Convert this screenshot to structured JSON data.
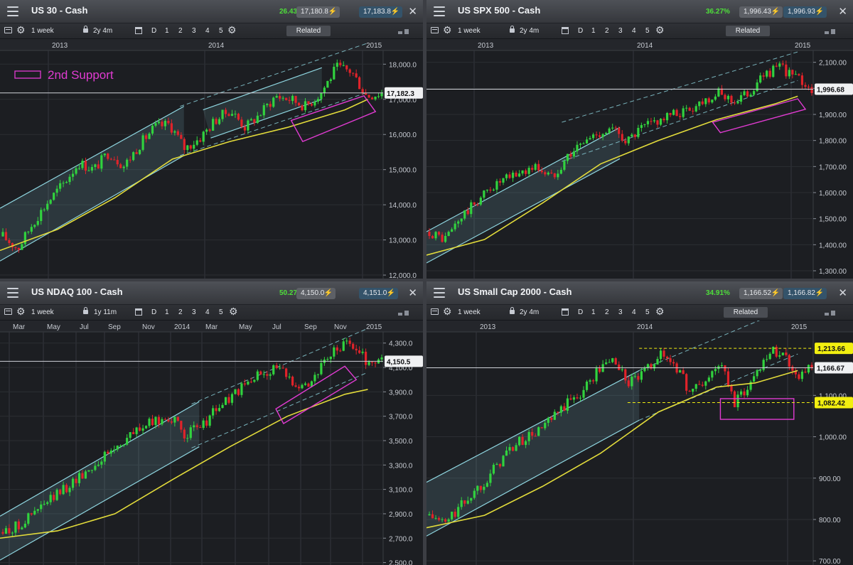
{
  "colors": {
    "up": "#31d23e",
    "down": "#e0232a",
    "channel": "#8fd6e0",
    "ma": "#e3dc3b",
    "annot": "#e13bd2",
    "level": "#f2ef10",
    "pct": "#4ede3a"
  },
  "toolbar_common": {
    "digits": [
      "D",
      "1",
      "2",
      "3",
      "4",
      "5"
    ],
    "related_label": "Related"
  },
  "panels": [
    {
      "title": "US 30 - Cash",
      "pct": "26.43%",
      "sell": "17,180.8",
      "buy": "17,183.8",
      "interval": "1 week",
      "range": "2y 4m",
      "show_related": true,
      "current_price": "17,182.3",
      "annotation_label": "2nd Support",
      "chart_data": {
        "type": "candlestick",
        "x_ticks": [
          "2013",
          "2014",
          "2015"
        ],
        "y_ticks": [
          "18,000.0",
          "17,000.0",
          "16,000.0",
          "15,000.0",
          "14,000.0",
          "13,000.0",
          "12,000.0"
        ],
        "y_range": [
          11900,
          18350
        ],
        "close_path": [
          13100,
          12750,
          13500,
          14100,
          14600,
          15200,
          15000,
          15500,
          15100,
          15700,
          16200,
          16300,
          15600,
          15900,
          16400,
          16700,
          16200,
          16600,
          17100,
          17000,
          16800,
          17200,
          17900,
          17800,
          17100,
          17182
        ],
        "channels": [
          {
            "from": [
              0,
              13900
            ],
            "to": [
              0.48,
              16800
            ]
          },
          {
            "from": [
              0,
              12400
            ],
            "to": [
              0.48,
              15400
            ]
          },
          {
            "from": [
              0.53,
              16700
            ],
            "to": [
              0.84,
              17900
            ]
          },
          {
            "from": [
              0.55,
              15900
            ],
            "to": [
              0.84,
              17000
            ]
          }
        ],
        "dashed": [
          {
            "from": [
              0.47,
              16800
            ],
            "to": [
              0.96,
              18600
            ]
          },
          {
            "from": [
              0.47,
              15400
            ],
            "to": [
              0.96,
              17200
            ]
          }
        ],
        "ma": [
          [
            0,
            12700
          ],
          [
            0.15,
            13300
          ],
          [
            0.3,
            14200
          ],
          [
            0.45,
            15300
          ],
          [
            0.6,
            15800
          ],
          [
            0.75,
            16200
          ],
          [
            0.9,
            16700
          ],
          [
            0.96,
            17000
          ]
        ],
        "support_box": {
          "corners": [
            [
              0.76,
              16400
            ],
            [
              0.95,
              17100
            ],
            [
              0.98,
              16650
            ],
            [
              0.79,
              15800
            ]
          ]
        }
      }
    },
    {
      "title": "US SPX 500 - Cash",
      "pct": "36.27%",
      "sell": "1,996.43",
      "buy": "1,996.93",
      "interval": "1 week",
      "range": "2y 4m",
      "show_related": true,
      "current_price": "1,996.68",
      "chart_data": {
        "type": "candlestick",
        "x_ticks": [
          "2013",
          "2014",
          "2015"
        ],
        "y_ticks": [
          "2,100.00",
          "2,000.00",
          "1,900.00",
          "1,800.00",
          "1,700.00",
          "1,600.00",
          "1,500.00",
          "1,400.00",
          "1,300.00"
        ],
        "y_range": [
          1270,
          2140
        ],
        "close_path": [
          1450,
          1420,
          1500,
          1560,
          1620,
          1650,
          1680,
          1700,
          1660,
          1740,
          1790,
          1830,
          1840,
          1800,
          1850,
          1880,
          1900,
          1920,
          1960,
          1980,
          1950,
          1990,
          2060,
          2080,
          2040,
          1997
        ],
        "channels": [
          {
            "from": [
              0,
              1450
            ],
            "to": [
              0.5,
              1850
            ]
          },
          {
            "from": [
              0,
              1330
            ],
            "to": [
              0.5,
              1730
            ]
          }
        ],
        "dashed": [
          {
            "from": [
              0.35,
              1870
            ],
            "to": [
              0.96,
              2140
            ]
          },
          {
            "from": [
              0.35,
              1720
            ],
            "to": [
              0.96,
              2030
            ]
          }
        ],
        "ma": [
          [
            0,
            1360
          ],
          [
            0.15,
            1420
          ],
          [
            0.3,
            1560
          ],
          [
            0.45,
            1710
          ],
          [
            0.6,
            1800
          ],
          [
            0.75,
            1880
          ],
          [
            0.9,
            1940
          ],
          [
            0.96,
            1970
          ]
        ],
        "support_box": {
          "corners": [
            [
              0.74,
              1870
            ],
            [
              0.96,
              1960
            ],
            [
              0.98,
              1920
            ],
            [
              0.76,
              1830
            ]
          ]
        }
      }
    },
    {
      "title": "US NDAQ 100 - Cash",
      "pct": "50.27%",
      "sell": "4,150.0",
      "buy": "4,151.0",
      "interval": "1 week",
      "range": "1y 11m",
      "show_related": false,
      "current_price": "4,150.5",
      "chart_data": {
        "type": "candlestick",
        "x_ticks": [
          "Mar",
          "May",
          "Jul",
          "Sep",
          "Nov",
          "2014",
          "Mar",
          "May",
          "Jul",
          "Sep",
          "Nov",
          "2015"
        ],
        "y_ticks": [
          "4,300.0",
          "4,100.0",
          "3,900.0",
          "3,700.0",
          "3,500.0",
          "3,300.0",
          "3,100.0",
          "2,900.0",
          "2,700.0",
          "2,500.0"
        ],
        "y_range": [
          2480,
          4380
        ],
        "close_path": [
          2750,
          2800,
          2900,
          3000,
          3100,
          3200,
          3300,
          3400,
          3500,
          3600,
          3650,
          3700,
          3550,
          3600,
          3750,
          3850,
          3950,
          4050,
          4100,
          4000,
          3950,
          4100,
          4250,
          4300,
          4150,
          4150
        ],
        "channels": [
          {
            "from": [
              0,
              2880
            ],
            "to": [
              0.52,
              3820
            ]
          },
          {
            "from": [
              0,
              2520
            ],
            "to": [
              0.52,
              3450
            ]
          }
        ],
        "dashed": [
          {
            "from": [
              0.5,
              3800
            ],
            "to": [
              0.96,
              4420
            ]
          },
          {
            "from": [
              0.5,
              3440
            ],
            "to": [
              0.96,
              4060
            ]
          }
        ],
        "ma": [
          [
            0,
            2700
          ],
          [
            0.15,
            2760
          ],
          [
            0.3,
            2900
          ],
          [
            0.45,
            3180
          ],
          [
            0.6,
            3450
          ],
          [
            0.75,
            3700
          ],
          [
            0.9,
            3880
          ],
          [
            0.96,
            3920
          ]
        ],
        "support_box": {
          "corners": [
            [
              0.72,
              3760
            ],
            [
              0.9,
              4110
            ],
            [
              0.93,
              4000
            ],
            [
              0.74,
              3640
            ]
          ]
        }
      }
    },
    {
      "title": "US Small Cap 2000 - Cash",
      "pct": "34.91%",
      "sell": "1,166.52",
      "buy": "1,166.82",
      "interval": "1 week",
      "range": "2y 4m",
      "show_related": true,
      "current_price": "1,166.67",
      "resistance_level": "1,213.66",
      "support_level": "1,082.42",
      "chart_data": {
        "type": "candlestick",
        "x_ticks": [
          "2013",
          "2014",
          "2015"
        ],
        "y_ticks": [
          "1,100.00",
          "1,000.00",
          "900.00",
          "800.00",
          "700.00"
        ],
        "y_range": [
          690,
          1250
        ],
        "close_path": [
          810,
          790,
          830,
          870,
          910,
          960,
          990,
          1010,
          1040,
          1080,
          1110,
          1160,
          1190,
          1130,
          1150,
          1200,
          1180,
          1110,
          1130,
          1180,
          1080,
          1130,
          1200,
          1210,
          1150,
          1167
        ],
        "channels": [
          {
            "from": [
              0,
              890
            ],
            "to": [
              0.55,
              1160
            ]
          },
          {
            "from": [
              0,
              760
            ],
            "to": [
              0.55,
              1040
            ]
          }
        ],
        "dashed": [
          {
            "from": [
              0.55,
              1160
            ],
            "to": [
              0.96,
              1320
            ]
          },
          {
            "from": [
              0.55,
              1040
            ],
            "to": [
              0.96,
              1200
            ]
          }
        ],
        "ma": [
          [
            0,
            780
          ],
          [
            0.15,
            810
          ],
          [
            0.3,
            880
          ],
          [
            0.45,
            960
          ],
          [
            0.6,
            1060
          ],
          [
            0.75,
            1120
          ],
          [
            0.85,
            1130
          ],
          [
            0.96,
            1160
          ]
        ],
        "support_box": {
          "corners": [
            [
              0.76,
              1092
            ],
            [
              0.95,
              1092
            ],
            [
              0.95,
              1042
            ],
            [
              0.76,
              1042
            ]
          ]
        }
      }
    }
  ]
}
